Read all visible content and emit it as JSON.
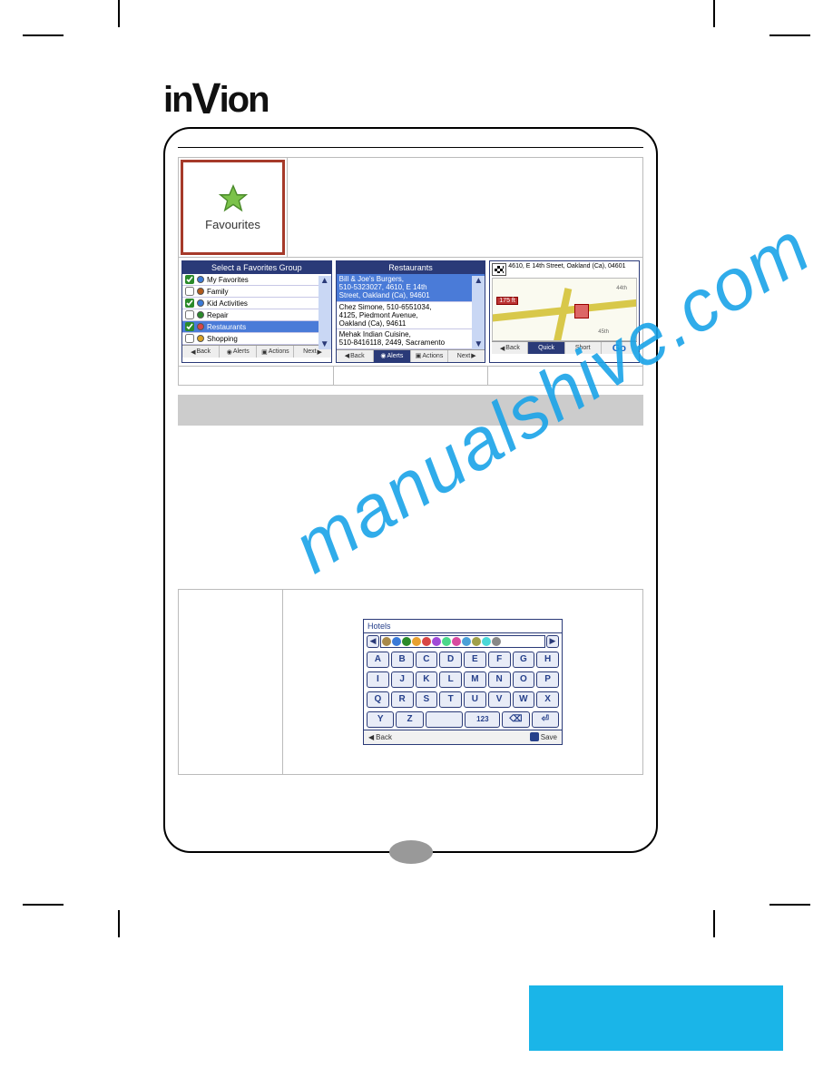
{
  "brand": "inVion",
  "watermark": "manualshive.com",
  "favourites_tile": {
    "label": "Favourites"
  },
  "gps1": {
    "title": "Select a Favorites Group",
    "items": [
      {
        "label": "My Favorites",
        "checked": true,
        "selected": false,
        "dot": "#3a7ad8"
      },
      {
        "label": "Family",
        "checked": false,
        "selected": false,
        "dot": "#b35a1a"
      },
      {
        "label": "Kid Activities",
        "checked": true,
        "selected": false,
        "dot": "#3a7ad8"
      },
      {
        "label": "Repair",
        "checked": false,
        "selected": false,
        "dot": "#2a8a2a"
      },
      {
        "label": "Restaurants",
        "checked": true,
        "selected": true,
        "dot": "#d84545"
      },
      {
        "label": "Shopping",
        "checked": false,
        "selected": false,
        "dot": "#d8a020"
      }
    ],
    "buttons": {
      "back": "Back",
      "alerts": "Alerts",
      "actions": "Actions",
      "next": "Next"
    }
  },
  "gps2": {
    "title": "Restaurants",
    "entries": [
      {
        "line1": "Bill & Joe's Burgers,",
        "line2": "510-5323027, 4610, E 14th",
        "line3": "Street, Oakland (Ca), 94601",
        "selected": true
      },
      {
        "line1": "Chez Simone, 510-6551034,",
        "line2": "4125, Piedmont Avenue,",
        "line3": "Oakland (Ca), 94611",
        "selected": false
      },
      {
        "line1": "Mehak Indian Cuisine,",
        "line2": "510-8416118, 2449, Sacramento",
        "line3": "",
        "selected": false
      }
    ],
    "buttons": {
      "back": "Back",
      "alerts": "Alerts",
      "actions": "Actions",
      "next": "Next"
    }
  },
  "gps3": {
    "address": "4610, E 14th Street, Oakland (Ca), 04601",
    "distance_badge": "175 ft",
    "road_label_1": "44th",
    "road_label_2": "45th",
    "buttons": {
      "back": "Back",
      "quick": "Quick",
      "short": "Short",
      "go": "Go"
    }
  },
  "keyboard": {
    "title": "Hotels",
    "icon_colors": [
      "#a8894a",
      "#3a7ad8",
      "#2a8a2a",
      "#e8a030",
      "#d84545",
      "#a04ad8",
      "#4ad88a",
      "#d84aa0",
      "#4aa0d8",
      "#a0a04a",
      "#4ad8d8",
      "#888"
    ],
    "rows": [
      [
        "A",
        "B",
        "C",
        "D",
        "E",
        "F",
        "G",
        "H"
      ],
      [
        "I",
        "J",
        "K",
        "L",
        "M",
        "N",
        "O",
        "P"
      ],
      [
        "Q",
        "R",
        "S",
        "T",
        "U",
        "V",
        "W",
        "X"
      ]
    ],
    "row4": {
      "y": "Y",
      "z": "Z",
      "num": "123",
      "bksp": "⌫",
      "ret": "⏎"
    },
    "bottom": {
      "back": "Back",
      "save": "Save"
    }
  }
}
